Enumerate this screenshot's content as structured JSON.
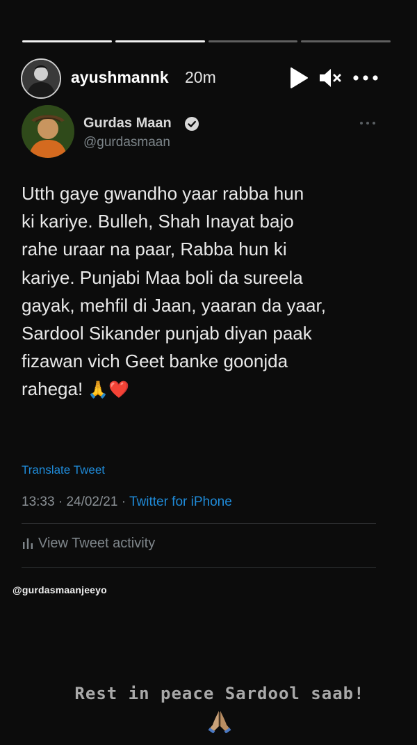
{
  "story": {
    "progress": {
      "total": 4,
      "completed": 2
    },
    "username": "ayushmannk",
    "time": "20m",
    "mention": "@gurdasmaanjeeyo",
    "caption": "Rest in peace Sardool saab!",
    "caption_emoji": "folded-hands"
  },
  "tweet": {
    "author_name": "Gurdas Maan",
    "verified": true,
    "handle": "@gurdasmaan",
    "text_lines": [
      "Utth gaye gwandho yaar rabba hun",
      "ki kariye. Bulleh, Shah Inayat bajo",
      "rahe uraar na paar, Rabba hun ki",
      "kariye. Punjabi Maa boli da sureela",
      "gayak, mehfil di Jaan, yaaran da yaar,",
      "Sardool Sikander punjab diyan paak",
      "fizawan vich Geet banke goonjda",
      "rahega!"
    ],
    "end_emojis": "🙏❤️",
    "translate_label": "Translate Tweet",
    "time": "13:33",
    "date": "24/02/21",
    "separator": "·",
    "source": "Twitter for iPhone",
    "activity_label": "View Tweet activity"
  },
  "colors": {
    "background": "#0c0c0c",
    "link": "#1f8bd9",
    "secondary_text": "#7c8489"
  }
}
